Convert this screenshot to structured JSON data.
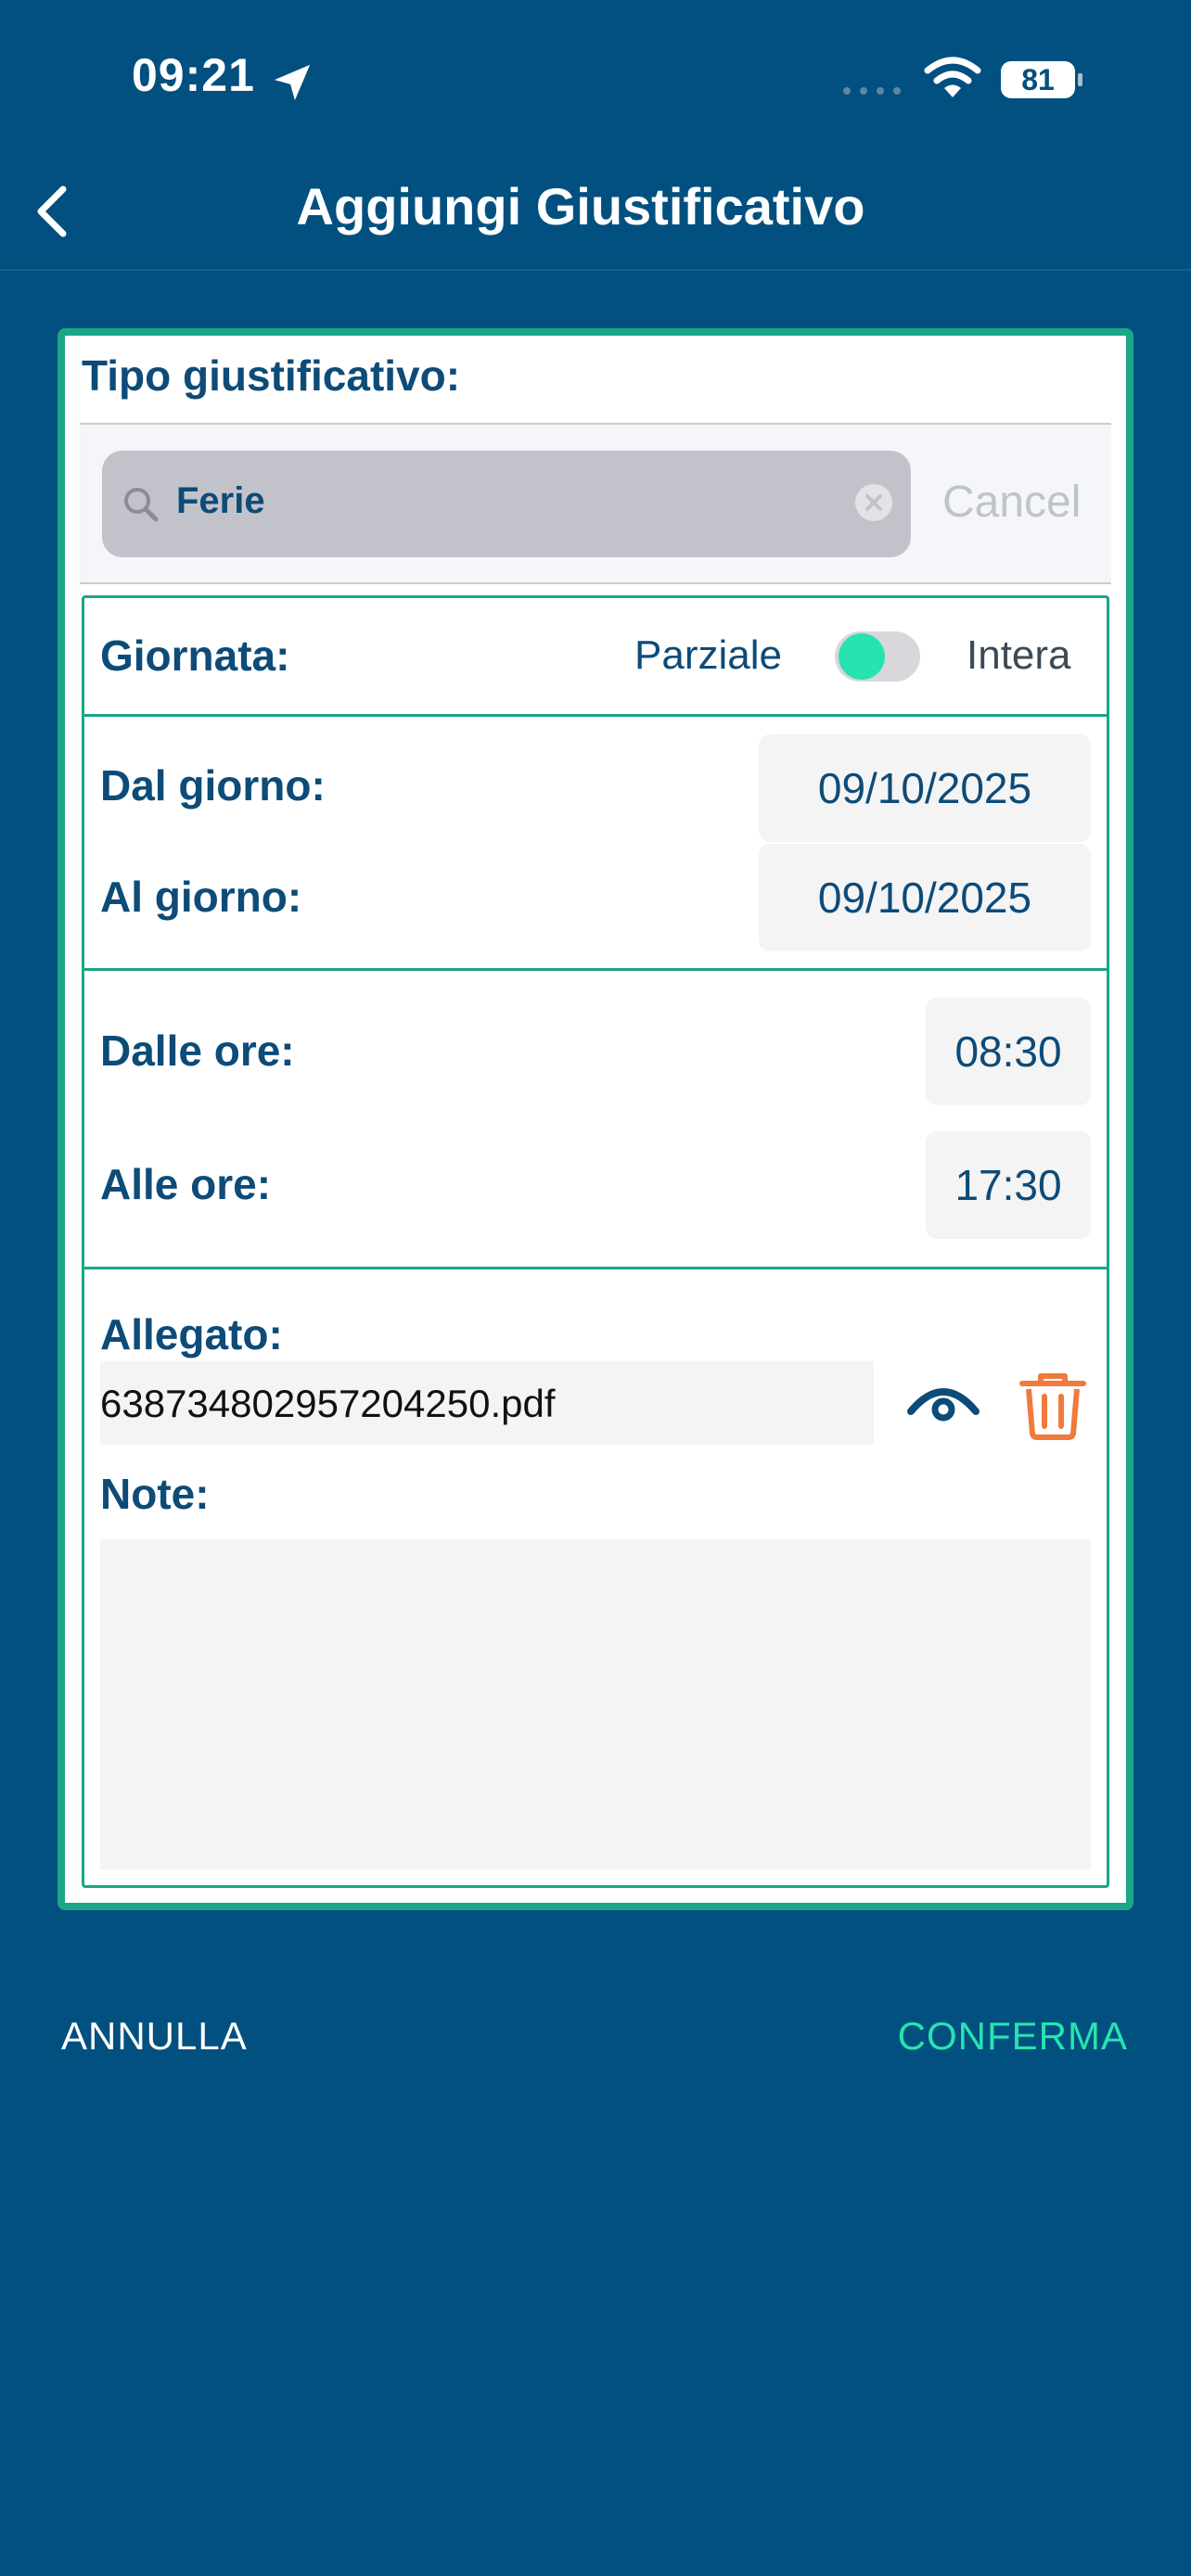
{
  "status_bar": {
    "time": "09:21",
    "battery": "81"
  },
  "header": {
    "title": "Aggiungi Giustificativo"
  },
  "form": {
    "tipo_label": "Tipo giustificativo:",
    "search": {
      "value": "Ferie",
      "cancel_label": "Cancel"
    },
    "giornata": {
      "label": "Giornata:",
      "left_option": "Parziale",
      "right_option": "Intera"
    },
    "dal_giorno": {
      "label": "Dal giorno:",
      "value": "09/10/2025"
    },
    "al_giorno": {
      "label": "Al giorno:",
      "value": "09/10/2025"
    },
    "dalle_ore": {
      "label": "Dalle ore:",
      "value": "08:30"
    },
    "alle_ore": {
      "label": "Alle ore:",
      "value": "17:30"
    },
    "allegato": {
      "label": "Allegato:",
      "file_name": "638734802957204250.pdf"
    },
    "note": {
      "label": "Note:",
      "value": ""
    }
  },
  "actions": {
    "cancel_label": "ANNULLA",
    "confirm_label": "CONFERMA"
  },
  "colors": {
    "background": "#02507f",
    "accent_teal": "#1aa688",
    "toggle_on": "#27e3b2",
    "label_blue": "#0d4b78",
    "delete_orange": "#f07a3e"
  },
  "icons": [
    "location-arrow-icon",
    "wifi-icon",
    "battery-icon",
    "back-chevron-icon",
    "search-icon",
    "clear-icon",
    "eye-icon",
    "trash-icon"
  ]
}
